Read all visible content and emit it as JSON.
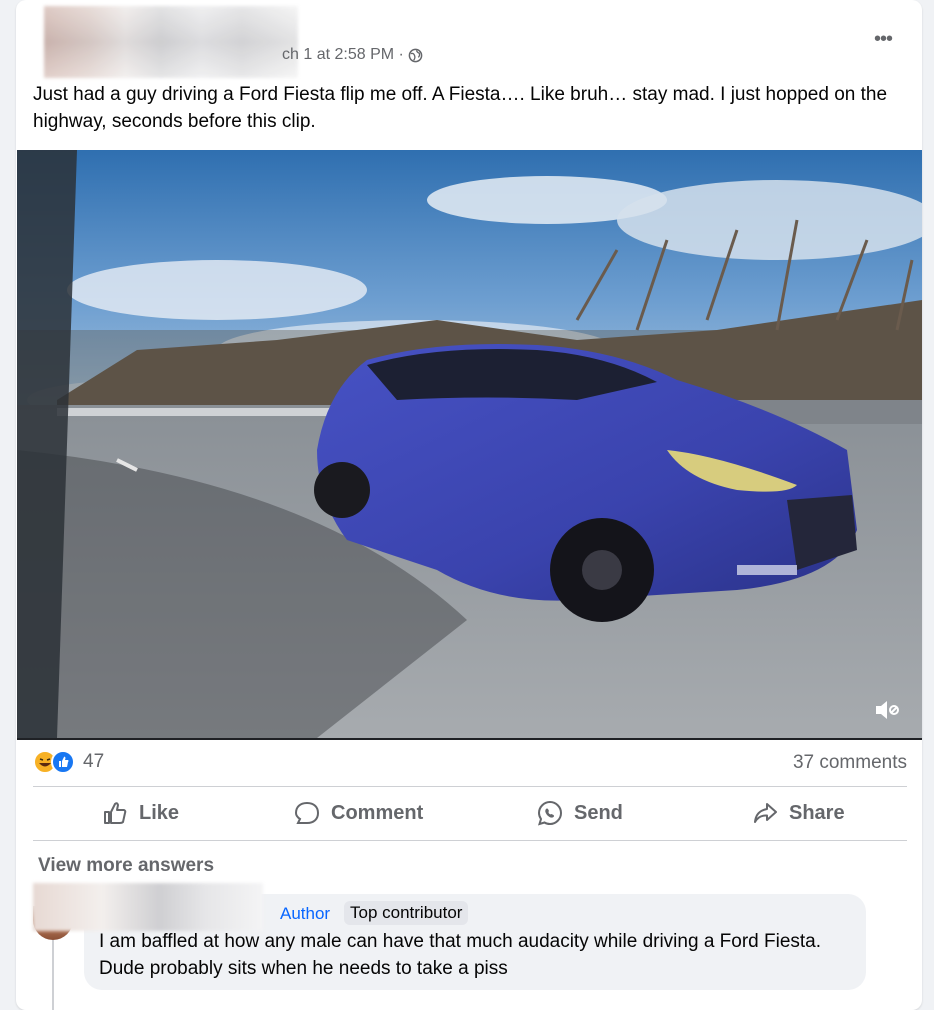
{
  "post": {
    "timestamp": "ch 1 at 2:58 PM ·",
    "text": "Just had a guy driving a Ford Fiesta flip me off. A Fiesta…. Like bruh… stay mad. I just hopped on the highway, seconds before this clip.",
    "more_label": "•••"
  },
  "stats": {
    "reaction_count": "47",
    "comments_count": "37 comments"
  },
  "actions": {
    "like": "Like",
    "comment": "Comment",
    "send": "Send",
    "share": "Share"
  },
  "comments": {
    "view_more": "View more answers",
    "author_label": "Author",
    "badge": "Top contributor",
    "text": "I am baffled at how any male can have that much audacity while driving a Ford Fiesta. Dude probably sits when he needs to take a piss"
  },
  "colors": {
    "accent": "#0866ff",
    "muted": "#65676b",
    "car": "#3d47b8"
  },
  "icons": [
    "globe-icon",
    "more-icon",
    "mute-icon",
    "haha-icon",
    "like-icon",
    "comment-icon",
    "send-icon",
    "share-icon"
  ]
}
